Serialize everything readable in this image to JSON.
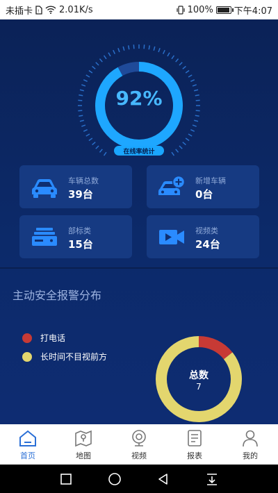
{
  "status_bar": {
    "carrier": "未插卡",
    "speed": "2.01K/s",
    "battery": "100%",
    "time": "下午4:07"
  },
  "gauge": {
    "percent": 92,
    "value_text": "92%",
    "label": "在线率统计",
    "colors": {
      "fill": "#1ea7ff",
      "remainder": "#1f4a99",
      "ticks": "#2a6fc9"
    }
  },
  "stats": [
    {
      "title": "车辆总数",
      "value": "39台",
      "icon": "car-icon"
    },
    {
      "title": "新增车辆",
      "value": "0台",
      "icon": "car-add-icon"
    },
    {
      "title": "部标类",
      "value": "15台",
      "icon": "device-icon"
    },
    {
      "title": "视频类",
      "value": "24台",
      "icon": "video-camera-icon"
    }
  ],
  "alarm": {
    "title": "主动安全报警分布",
    "legend": [
      {
        "label": "打电话",
        "color": "#c73a35"
      },
      {
        "label": "长时间不目视前方",
        "color": "#e3d66e"
      }
    ],
    "total_label": "总数",
    "total_value": "7"
  },
  "chart_data": {
    "type": "pie",
    "categories": [
      "打电话",
      "长时间不目视前方"
    ],
    "values": [
      1,
      6
    ],
    "colors": [
      "#c73a35",
      "#e3d66e"
    ]
  },
  "tabs": [
    {
      "label": "首页",
      "icon": "home-icon",
      "active": true
    },
    {
      "label": "地图",
      "icon": "map-icon",
      "active": false
    },
    {
      "label": "视频",
      "icon": "webcam-icon",
      "active": false
    },
    {
      "label": "报表",
      "icon": "report-icon",
      "active": false
    },
    {
      "label": "我的",
      "icon": "user-icon",
      "active": false
    }
  ]
}
